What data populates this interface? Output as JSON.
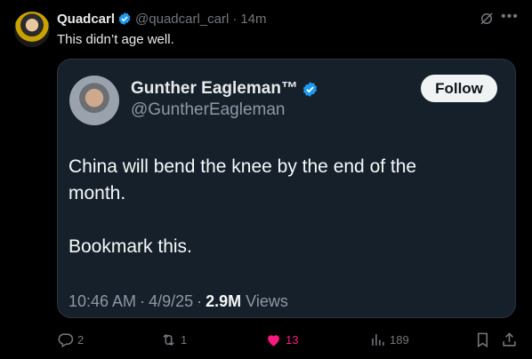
{
  "post": {
    "author_name": "Quadcarl",
    "author_handle": "@quadcarl_carl",
    "separator": "·",
    "time": "14m",
    "text": "This didn’t age well."
  },
  "quoted": {
    "author_name": "Gunther Eagleman™",
    "author_handle": "@GuntherEagleman",
    "follow_label": "Follow",
    "paragraphs": [
      "China will bend the knee by the end of the month.",
      "Bookmark this."
    ],
    "time": "10:46 AM",
    "date": "4/9/25",
    "views_count": "2.9M",
    "views_label": "Views"
  },
  "actions": {
    "replies": "2",
    "reposts": "1",
    "likes": "13",
    "views": "189"
  },
  "colors": {
    "verified": "#1d9bf0",
    "like": "#f91880",
    "card_bg": "#15202b"
  },
  "icons": [
    "verified-badge-icon",
    "grok-icon",
    "more-icon",
    "reply-icon",
    "repost-icon",
    "like-icon",
    "views-icon",
    "bookmark-icon",
    "share-icon"
  ]
}
